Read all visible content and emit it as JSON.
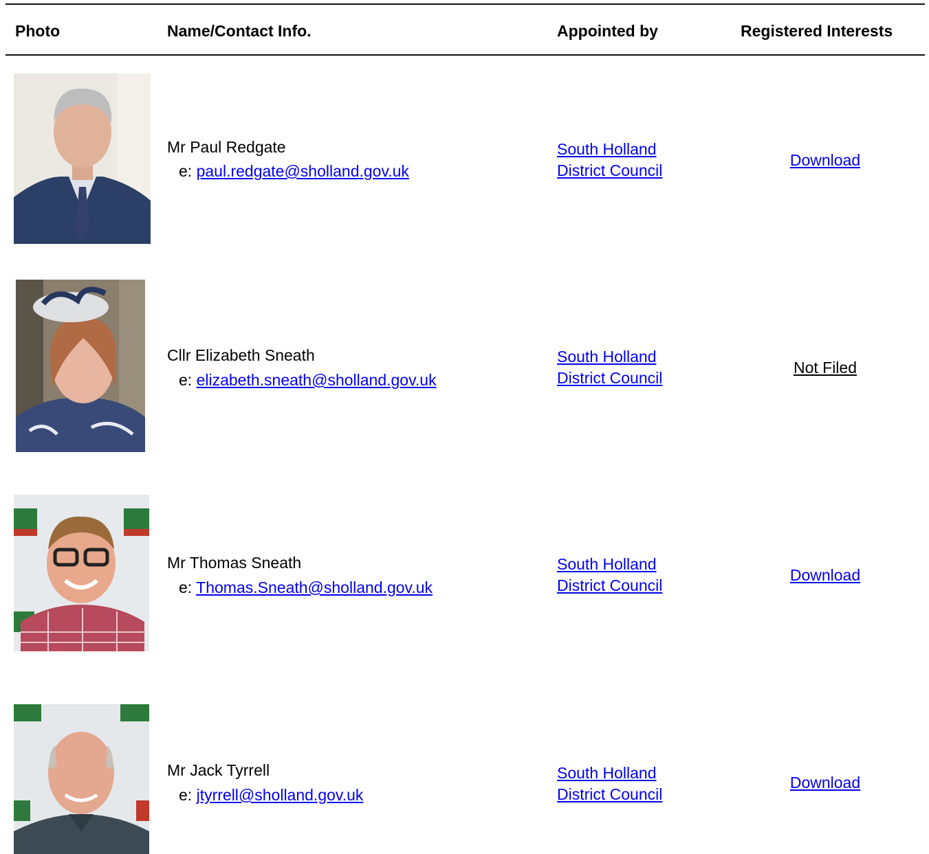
{
  "header": {
    "photo": "Photo",
    "name_contact": "Name/Contact Info.",
    "appointed_by": "Appointed by",
    "registered_interests": "Registered Interests"
  },
  "members": [
    {
      "name": "Mr Paul Redgate",
      "email_prefix": "e:",
      "email": "paul.redgate@sholland.gov.uk",
      "appointed_line1": "South Holland",
      "appointed_line2": "District Council",
      "interests": "Download",
      "interests_is_link": true,
      "photo_icon": "portrait-man-suit"
    },
    {
      "name": "Cllr Elizabeth Sneath",
      "email_prefix": "e:",
      "email": "elizabeth.sneath@sholland.gov.uk",
      "appointed_line1": "South Holland",
      "appointed_line2": "District Council",
      "interests": "Not Filed",
      "interests_is_link": false,
      "photo_icon": "portrait-woman-fascinator"
    },
    {
      "name": "Mr Thomas Sneath",
      "email_prefix": "e:",
      "email": "Thomas.Sneath@sholland.gov.uk",
      "appointed_line1": "South Holland",
      "appointed_line2": "District Council",
      "interests": "Download",
      "interests_is_link": true,
      "photo_icon": "portrait-man-glasses"
    },
    {
      "name": "Mr Jack Tyrrell",
      "email_prefix": "e:",
      "email": "jtyrrell@sholland.gov.uk",
      "appointed_line1": "South Holland",
      "appointed_line2": "District Council",
      "interests": "Download",
      "interests_is_link": true,
      "photo_icon": "portrait-man-bald"
    }
  ],
  "colors": {
    "link": "#0000ee",
    "text": "#000000",
    "rule": "#111111"
  }
}
